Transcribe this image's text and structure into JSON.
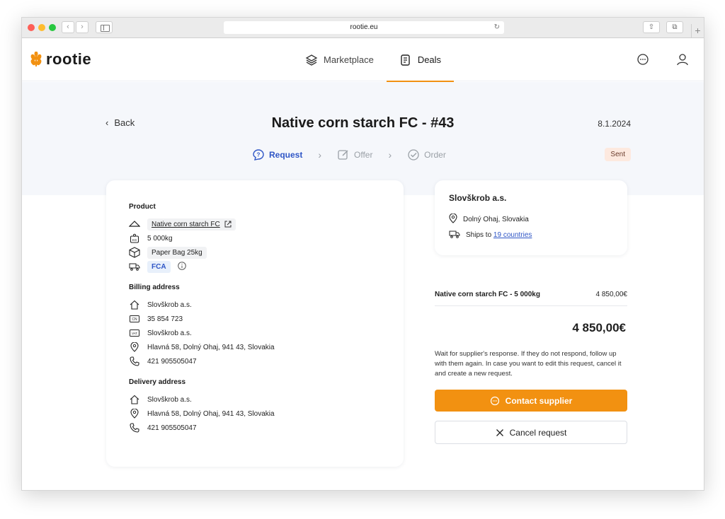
{
  "browser": {
    "url": "rootie.eu"
  },
  "header": {
    "logo_text": "rootie",
    "nav": [
      {
        "label": "Marketplace",
        "icon": "layers-icon"
      },
      {
        "label": "Deals",
        "icon": "document-icon"
      }
    ]
  },
  "page": {
    "back_label": "Back",
    "title": "Native corn starch FC - #43",
    "date": "8.1.2024",
    "status": "Sent",
    "steps": [
      {
        "label": "Request",
        "active": true
      },
      {
        "label": "Offer",
        "active": false
      },
      {
        "label": "Order",
        "active": false
      }
    ]
  },
  "product": {
    "section_title": "Product",
    "name": "Native corn starch FC",
    "quantity": "5 000kg",
    "packaging": "Paper Bag 25kg",
    "incoterm": "FCA"
  },
  "billing": {
    "section_title": "Billing address",
    "company": "Slovškrob a.s.",
    "cn": "35 854 723",
    "vat": "Slovškrob a.s.",
    "address": "Hlavná 58, Dolný Ohaj, 941 43, Slovakia",
    "phone": "421 905505047"
  },
  "delivery": {
    "section_title": "Delivery address",
    "company": "Slovškrob a.s.",
    "address": "Hlavná 58, Dolný Ohaj, 941 43, Slovakia",
    "phone": "421 905505047"
  },
  "supplier": {
    "name": "Slovškrob a.s.",
    "location": "Dolný Ohaj, Slovakia",
    "ships_prefix": "Ships to",
    "ships_link": "19 countries"
  },
  "summary": {
    "line_label": "Native corn starch FC - 5 000kg",
    "line_price": "4 850,00€",
    "total": "4 850,00€",
    "note": "Wait for supplier's response. If they do not respond, follow up with them again. In case you want to edit this request, cancel it and create a new request.",
    "contact_label": "Contact supplier",
    "cancel_label": "Cancel request"
  },
  "colors": {
    "accent": "#f29111",
    "link": "#2f56c6",
    "band": "#f5f7fb"
  }
}
